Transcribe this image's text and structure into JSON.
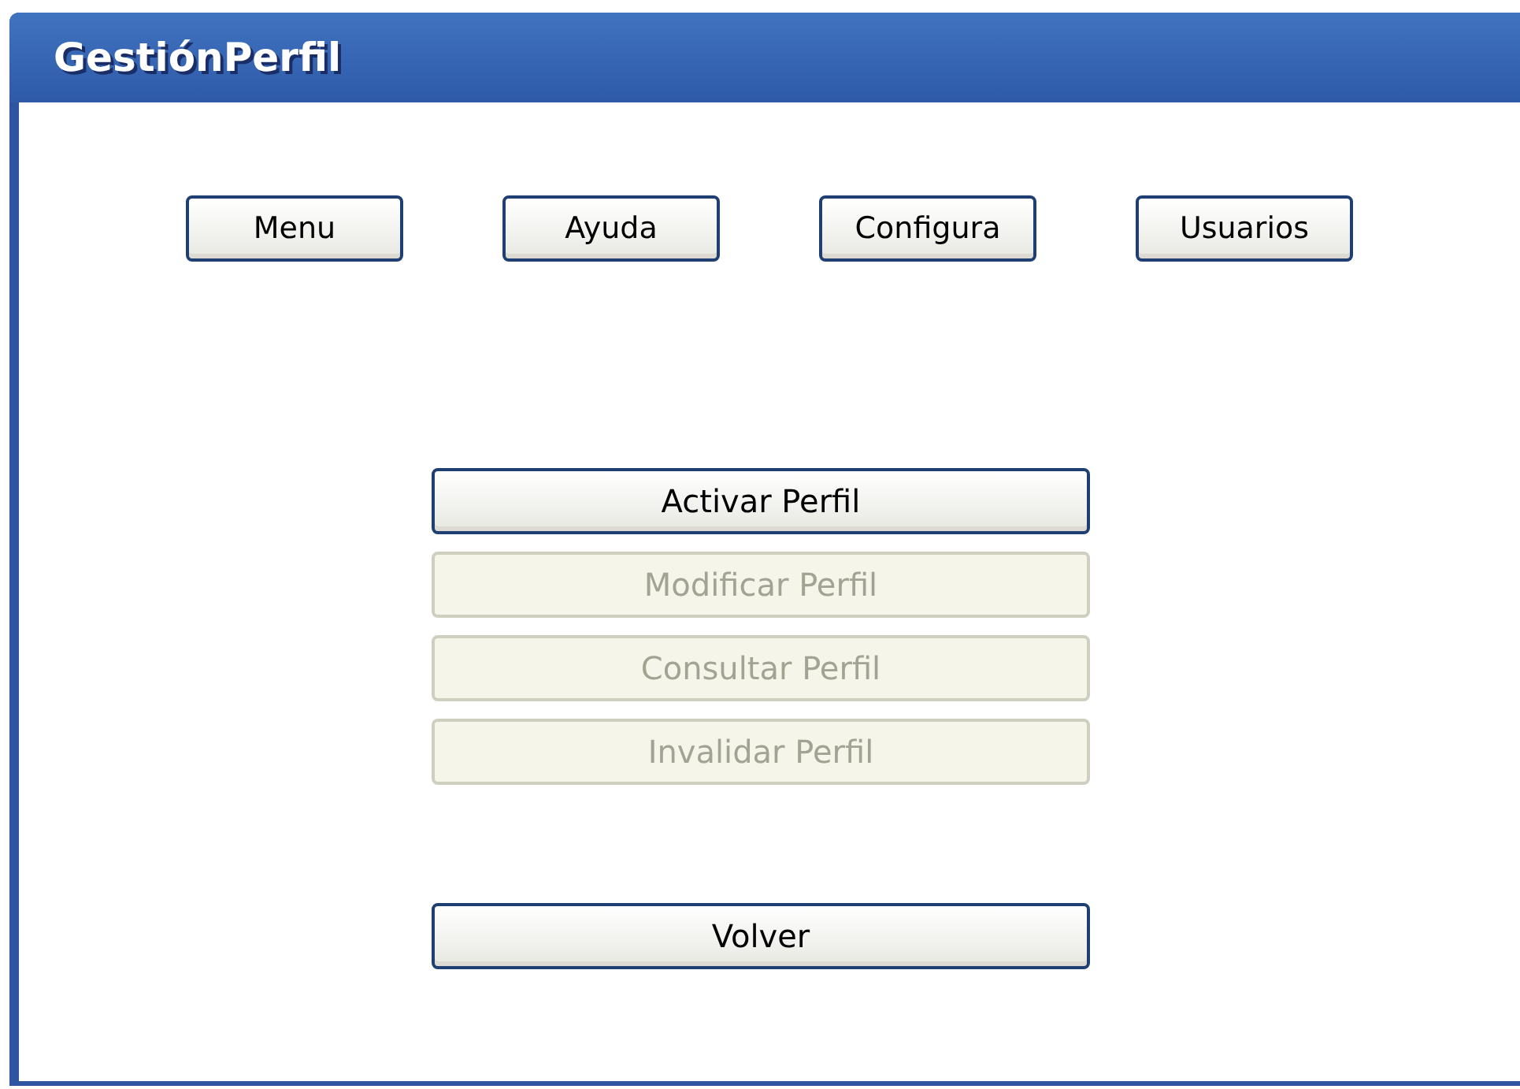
{
  "window": {
    "title": "GestiónPerfil"
  },
  "nav_buttons": [
    {
      "label": "Menu"
    },
    {
      "label": "Ayuda"
    },
    {
      "label": "Configura"
    },
    {
      "label": "Usuarios"
    }
  ],
  "profile_actions": [
    {
      "label": "Activar Perfil",
      "disabled": false
    },
    {
      "label": "Modificar Perfil",
      "disabled": true
    },
    {
      "label": "Consultar Perfil",
      "disabled": true
    },
    {
      "label": "Invalidar Perfil",
      "disabled": true
    }
  ],
  "back_button": {
    "label": "Volver",
    "disabled": false
  }
}
